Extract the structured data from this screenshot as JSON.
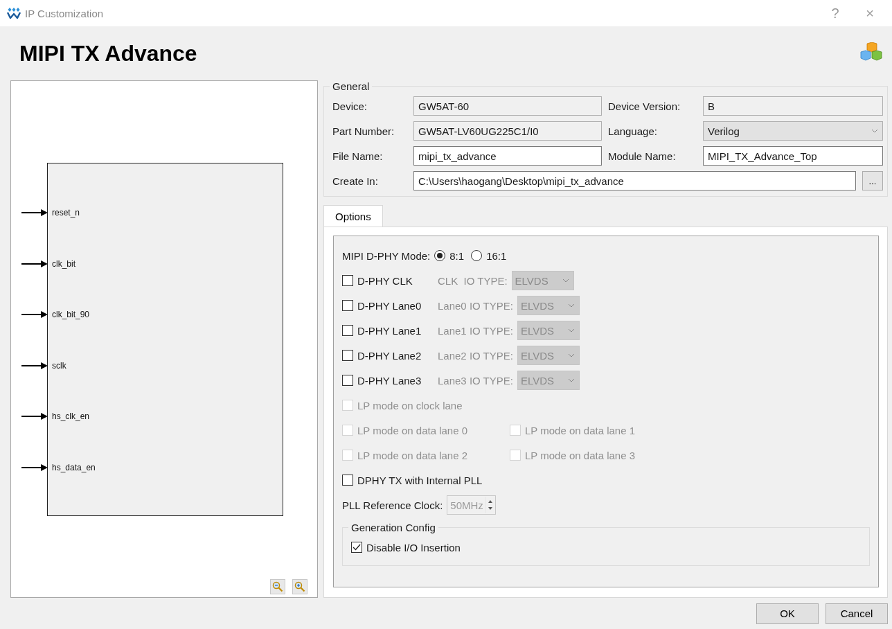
{
  "window": {
    "title": "IP Customization",
    "help": "?",
    "close": "×"
  },
  "heading": "MIPI TX Advance",
  "diagram": {
    "pins": [
      "reset_n",
      "clk_bit",
      "clk_bit_90",
      "sclk",
      "hs_clk_en",
      "hs_data_en"
    ]
  },
  "general": {
    "title": "General",
    "rows": [
      [
        {
          "label": "Device:",
          "value": "GW5AT-60",
          "kind": "readonly"
        },
        {
          "label": "Device Version:",
          "value": "B",
          "kind": "readonly"
        }
      ],
      [
        {
          "label": "Part Number:",
          "value": "GW5AT-LV60UG225C1/I0",
          "kind": "readonly"
        },
        {
          "label": "Language:",
          "value": "Verilog",
          "kind": "select"
        }
      ],
      [
        {
          "label": "File Name:",
          "value": "mipi_tx_advance",
          "kind": "input"
        },
        {
          "label": "Module Name:",
          "value": "MIPI_TX_Advance_Top",
          "kind": "input"
        }
      ]
    ],
    "create_in": {
      "label": "Create In:",
      "value": "C:\\Users\\haogang\\Desktop\\mipi_tx_advance",
      "browse": "..."
    }
  },
  "tabs": [
    {
      "label": "Options",
      "selected": true
    }
  ],
  "mode": {
    "label": "MIPI D-PHY Mode:",
    "options": [
      {
        "label": "8:1",
        "selected": true
      },
      {
        "label": "16:1",
        "selected": false
      }
    ]
  },
  "lanes": [
    {
      "label": "D-PHY CLK",
      "checked": false,
      "io_label": "CLK  IO TYPE:",
      "io_value": "ELVDS",
      "io_disabled": true
    },
    {
      "label": "D-PHY Lane0",
      "checked": false,
      "io_label": "Lane0 IO TYPE:",
      "io_value": "ELVDS",
      "io_disabled": true
    },
    {
      "label": "D-PHY Lane1",
      "checked": false,
      "io_label": "Lane1 IO TYPE:",
      "io_value": "ELVDS",
      "io_disabled": true
    },
    {
      "label": "D-PHY Lane2",
      "checked": false,
      "io_label": "Lane2 IO TYPE:",
      "io_value": "ELVDS",
      "io_disabled": true
    },
    {
      "label": "D-PHY Lane3",
      "checked": false,
      "io_label": "Lane3 IO TYPE:",
      "io_value": "ELVDS",
      "io_disabled": true
    }
  ],
  "lp_rows": [
    [
      {
        "label": "LP mode on clock lane",
        "checked": false,
        "disabled": true
      }
    ],
    [
      {
        "label": "LP mode on data lane 0",
        "checked": false,
        "disabled": true
      },
      {
        "label": "LP mode on data lane 1",
        "checked": false,
        "disabled": true
      }
    ],
    [
      {
        "label": "LP mode on data lane 2",
        "checked": false,
        "disabled": true
      },
      {
        "label": "LP mode on data lane 3",
        "checked": false,
        "disabled": true
      }
    ]
  ],
  "pll": {
    "label": "DPHY TX with Internal PLL",
    "checked": false,
    "disabled": false
  },
  "ref_clock": {
    "label": "PLL Reference Clock:",
    "value": "50MHz",
    "disabled": true
  },
  "generation": {
    "title": "Generation Config",
    "options": [
      {
        "label": "Disable I/O Insertion",
        "checked": true,
        "disabled": false
      }
    ]
  },
  "buttons": [
    "OK",
    "Cancel"
  ]
}
